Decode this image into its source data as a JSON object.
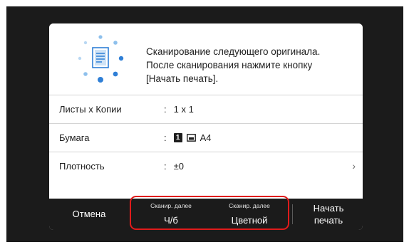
{
  "message": {
    "line1": "Сканирование следующего оригинала.",
    "line2": "После сканирования нажмите кнопку",
    "line3": "[Начать печать]."
  },
  "settings": [
    {
      "label": "Листы x Копии",
      "value": "1 x 1"
    },
    {
      "label": "Бумага",
      "tray_number": "1",
      "value": "A4"
    },
    {
      "label": "Плотность",
      "value": "±0"
    }
  ],
  "colon": ":",
  "buttons": {
    "cancel": "Отмена",
    "scan_next_caption": "Сканир. далее",
    "scan_next_sides": "Ч/б",
    "scan_next_color": "Цветной",
    "start_line1": "Начать",
    "start_line2": "печать"
  },
  "colors": {
    "highlight": "#e01b1b",
    "icon_blue": "#2f7fd6",
    "icon_light_blue": "#8ec0ec"
  },
  "icons": [
    "scanning-document-icon",
    "tray-icon",
    "chevron-right-icon"
  ]
}
